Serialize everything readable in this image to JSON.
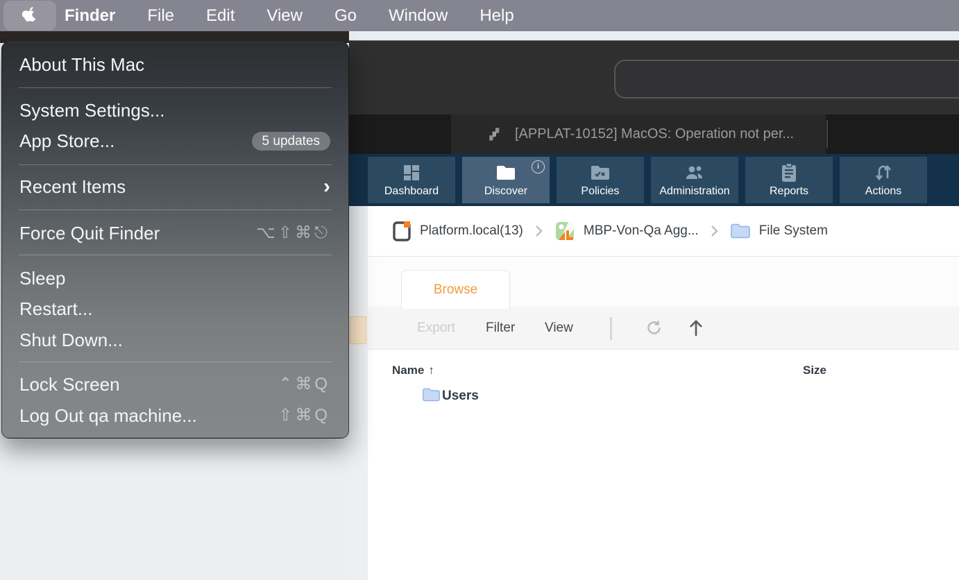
{
  "menu_bar": {
    "items": [
      "Finder",
      "File",
      "Edit",
      "View",
      "Go",
      "Window",
      "Help"
    ]
  },
  "apple_menu": {
    "about": "About This Mac",
    "system_settings": "System Settings...",
    "app_store": "App Store...",
    "app_store_badge": "5 updates",
    "recent_items": "Recent Items",
    "recent_items_chevron": "›",
    "force_quit": "Force Quit Finder",
    "force_quit_shortcut": "⌥⇧⌘⎋",
    "sleep": "Sleep",
    "restart": "Restart...",
    "shut_down": "Shut Down...",
    "lock_screen": "Lock Screen",
    "lock_screen_shortcut": "⌃⌘Q",
    "log_out": "Log Out qa machine...",
    "log_out_shortcut": "⇧⌘Q"
  },
  "browser": {
    "active_tab_title": "[APPLAT-10152] MacOS: Operation not per..."
  },
  "nav": {
    "tabs": [
      {
        "label": "Dashboard"
      },
      {
        "label": "Discover",
        "selected": true,
        "info": "i"
      },
      {
        "label": "Policies"
      },
      {
        "label": "Administration"
      },
      {
        "label": "Reports"
      },
      {
        "label": "Actions"
      }
    ]
  },
  "breadcrumb": {
    "items": [
      {
        "label": "Platform.local(13)"
      },
      {
        "label": "MBP-Von-Qa Agg..."
      },
      {
        "label": "File System"
      }
    ]
  },
  "content": {
    "tab_label": "Browse"
  },
  "toolbar": {
    "export_label": "Export",
    "filter_label": "Filter",
    "view_label": "View"
  },
  "table": {
    "columns": [
      {
        "label": "Name",
        "sort": "↑"
      },
      {
        "label": "Size"
      }
    ],
    "rows": [
      {
        "name": "Users"
      }
    ]
  },
  "colors": {
    "accent_orange": "#F49B3D",
    "nav_blue": "#13314A",
    "nav_tab_blue": "#2B4A62",
    "nav_tab_selected": "#47617A",
    "menu_dark_top": "#2C2E31",
    "menu_gray_bottom": "#848688"
  }
}
